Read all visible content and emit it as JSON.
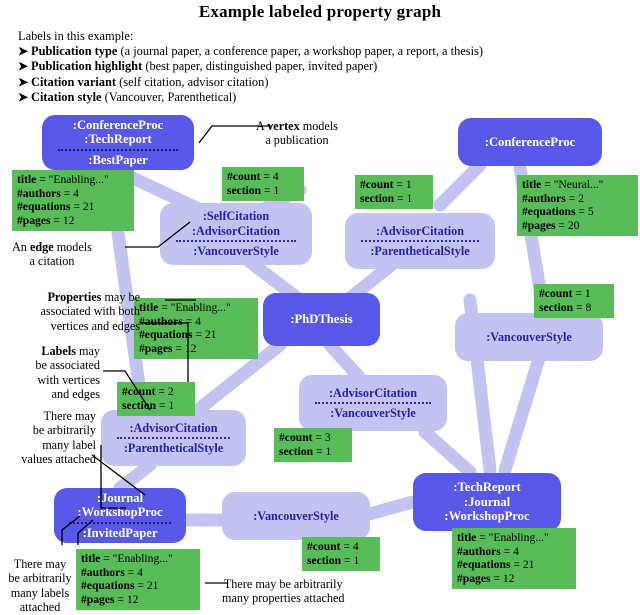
{
  "header": {
    "title": "Example labeled property graph",
    "legend_intro": "Labels in this example:",
    "legend_items": [
      {
        "term": "Publication type",
        "detail": "(a journal paper, a conference paper, a workshop paper, a report, a thesis)"
      },
      {
        "term": "Publication highlight",
        "detail": "(best paper, distinguished paper, invited paper)"
      },
      {
        "term": "Citation variant",
        "detail": "(self citation, advisor citation)"
      },
      {
        "term": "Citation style",
        "detail": "(Vancouver, Parenthetical)"
      }
    ]
  },
  "colors": {
    "vertex_fill": "#5757E8",
    "vertex_text": "#FFFFFF",
    "edge_fill": "#C3C3F2",
    "edge_text": "#2323A8",
    "property_fill": "#58BC58",
    "property_text": "#000000",
    "background": "#FFFFFF"
  },
  "vertices": [
    {
      "id": "v1",
      "labels_top": [
        ":ConferenceProc",
        ":TechReport"
      ],
      "labels_bottom": [
        ":BestPaper"
      ]
    },
    {
      "id": "v2",
      "labels_top": [
        ":ConferenceProc"
      ],
      "labels_bottom": []
    },
    {
      "id": "v3",
      "labels_top": [
        ":PhDThesis"
      ],
      "labels_bottom": []
    },
    {
      "id": "v4",
      "labels_top": [
        ":Journal",
        ":WorkshopProc"
      ],
      "labels_bottom": [
        ":InvitedPaper"
      ]
    },
    {
      "id": "v5",
      "labels_top": [
        ":TechReport",
        ":Journal",
        ":WorkshopProc"
      ],
      "labels_bottom": []
    }
  ],
  "edge_nodes": [
    {
      "id": "e1",
      "labels_top": [
        ":SelfCitation",
        ":AdvisorCitation"
      ],
      "labels_bottom": [
        ":VancouverStyle"
      ]
    },
    {
      "id": "e2",
      "labels_top": [
        ":AdvisorCitation"
      ],
      "labels_bottom": [
        ":ParentheticalStyle"
      ]
    },
    {
      "id": "e3",
      "labels_top": [
        ":VancouverStyle"
      ],
      "labels_bottom": []
    },
    {
      "id": "e4",
      "labels_top": [
        ":AdvisorCitation"
      ],
      "labels_bottom": [
        ":VancouverStyle"
      ]
    },
    {
      "id": "e5",
      "labels_top": [
        ":AdvisorCitation"
      ],
      "labels_bottom": [
        ":ParentheticalStyle"
      ]
    },
    {
      "id": "e6",
      "labels_top": [
        ":VancouverStyle"
      ],
      "labels_bottom": []
    }
  ],
  "property_boxes": [
    {
      "id": "p1",
      "for": "v1",
      "rows": [
        {
          "key": "title",
          "value": "= \"Enabling...\""
        },
        {
          "key": "#authors",
          "value": "= 4"
        },
        {
          "key": "#equations",
          "value": "= 21"
        },
        {
          "key": "#pages",
          "value": "= 12"
        }
      ]
    },
    {
      "id": "p2",
      "for": "e1",
      "rows": [
        {
          "key": "#count",
          "value": "= 4"
        },
        {
          "key": "section",
          "value": "= 1"
        }
      ]
    },
    {
      "id": "p3",
      "for": "e2",
      "rows": [
        {
          "key": "#count",
          "value": "= 1"
        },
        {
          "key": "section",
          "value": "= 1"
        }
      ]
    },
    {
      "id": "p4",
      "for": "v2",
      "rows": [
        {
          "key": "title",
          "value": "= \"Neural...\""
        },
        {
          "key": "#authors",
          "value": "= 2"
        },
        {
          "key": "#equations",
          "value": "= 5"
        },
        {
          "key": "#pages",
          "value": "= 20"
        }
      ]
    },
    {
      "id": "p5",
      "for": "v3",
      "rows": [
        {
          "key": "title",
          "value": "= \"Enabling...\""
        },
        {
          "key": "#authors",
          "value": "= 4"
        },
        {
          "key": "#equations",
          "value": "= 21"
        },
        {
          "key": "#pages",
          "value": "= 12"
        }
      ]
    },
    {
      "id": "p6",
      "for": "e3",
      "rows": [
        {
          "key": "#count",
          "value": "= 1"
        },
        {
          "key": "section",
          "value": "= 8"
        }
      ]
    },
    {
      "id": "p7",
      "for": "e5",
      "rows": [
        {
          "key": "#count",
          "value": "= 2"
        },
        {
          "key": "section",
          "value": "= 1"
        }
      ]
    },
    {
      "id": "p8",
      "for": "e4",
      "rows": [
        {
          "key": "#count",
          "value": "= 3"
        },
        {
          "key": "section",
          "value": "= 1"
        }
      ]
    },
    {
      "id": "p9",
      "for": "e6",
      "rows": [
        {
          "key": "#count",
          "value": "= 4"
        },
        {
          "key": "section",
          "value": "= 1"
        }
      ]
    },
    {
      "id": "p10",
      "for": "v4",
      "rows": [
        {
          "key": "title",
          "value": "= \"Enabling...\""
        },
        {
          "key": "#authors",
          "value": "= 4"
        },
        {
          "key": "#equations",
          "value": "= 21"
        },
        {
          "key": "#pages",
          "value": "= 12"
        }
      ]
    },
    {
      "id": "p11",
      "for": "v5",
      "rows": [
        {
          "key": "title",
          "value": "= \"Enabling...\""
        },
        {
          "key": "#authors",
          "value": "= 4"
        },
        {
          "key": "#equations",
          "value": "= 21"
        },
        {
          "key": "#pages",
          "value": "= 12"
        }
      ]
    }
  ],
  "annotations": {
    "vertex_models": {
      "line1_pre": "A ",
      "line1_bold": "vertex",
      "line1_post": " models",
      "line2": "a publication"
    },
    "edge_models": {
      "line1_pre": "An ",
      "line1_bold": "edge",
      "line1_post": " models",
      "line2": "a citation"
    },
    "properties_note": {
      "bold": "Properties",
      "rest": " may be",
      "line2": "associated with both",
      "line3": "vertices and edges"
    },
    "labels_note": {
      "bold": "Labels",
      "rest": " may",
      "line2": "be associated",
      "line3": "with vertices",
      "line4": "and edges"
    },
    "many_label_values": {
      "line1": "There may",
      "line2": "be arbitrarily",
      "line3": "many label",
      "line4": "values attached"
    },
    "many_labels": {
      "line1": "There may",
      "line2": "be arbitrarily",
      "line3": "many labels",
      "line4": "attached"
    },
    "many_properties": {
      "line1": "There may be arbitrarily",
      "line2": "many properties attached"
    }
  }
}
